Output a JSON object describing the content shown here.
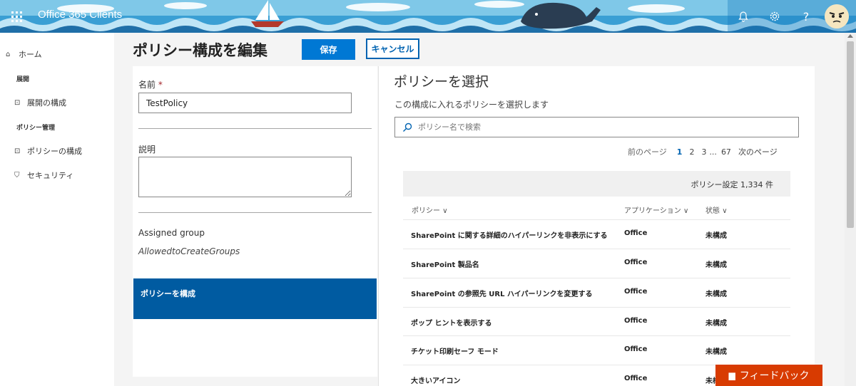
{
  "header": {
    "app_title": "Office 365 Clients",
    "icons": [
      "waffle-icon",
      "bell-icon",
      "gear-icon",
      "help-icon",
      "avatar"
    ]
  },
  "sidebar": {
    "items": [
      {
        "label": "ホーム",
        "icon": "home-icon"
      },
      {
        "label": "展開",
        "type": "header"
      },
      {
        "label": "展開の構成",
        "icon": "config-icon"
      },
      {
        "label": "ポリシー管理",
        "type": "header"
      },
      {
        "label": "ポリシーの構成",
        "icon": "config-icon"
      },
      {
        "label": "セキュリティ",
        "icon": "security-icon"
      }
    ]
  },
  "page": {
    "title": "ポリシー構成を編集",
    "save_label": "保存",
    "cancel_label": "キャンセル"
  },
  "form": {
    "name_label": "名前",
    "required_mark": "*",
    "name_value": "TestPolicy",
    "description_label": "説明",
    "description_value": "",
    "assigned_group_label": "Assigned group",
    "assigned_group_value": "AllowedtoCreateGroups",
    "configure_policy_label": "ポリシーを構成"
  },
  "policy_select": {
    "title": "ポリシーを選択",
    "subtitle": "この構成に入れるポリシーを選択します",
    "search_placeholder": "ポリシー名で検索",
    "pager": {
      "prev": "前のページ",
      "pages": [
        "1",
        "2",
        "3"
      ],
      "ellipsis": "...",
      "last": "67",
      "next": "次のページ"
    },
    "count_text": "ポリシー設定 1,334 件",
    "columns": [
      "ポリシー",
      "アプリケーション",
      "状態"
    ],
    "rows": [
      {
        "policy": "SharePoint に関する詳細のハイパーリンクを非表示にする",
        "app": "Office",
        "status": "未構成"
      },
      {
        "policy": "SharePoint 製品名",
        "app": "Office",
        "status": "未構成"
      },
      {
        "policy": "SharePoint の参照先 URL ハイパーリンクを変更する",
        "app": "Office",
        "status": "未構成"
      },
      {
        "policy": "ポップ ヒントを表示する",
        "app": "Office",
        "status": "未構成"
      },
      {
        "policy": "チケット印刷セーフ モード",
        "app": "Office",
        "status": "未構成"
      },
      {
        "policy": "大きいアイコン",
        "app": "Office",
        "status": "未構成"
      }
    ]
  },
  "feedback_label": "フィードバック",
  "colors": {
    "accent": "#0078d4",
    "selected": "#005ba1",
    "feedback": "#d83b01"
  }
}
